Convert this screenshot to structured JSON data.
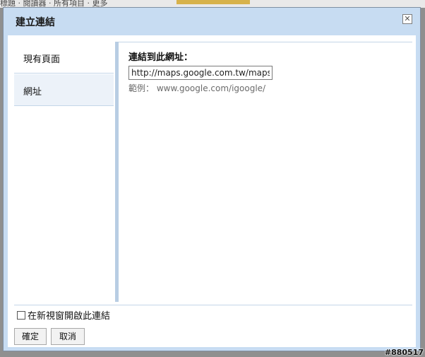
{
  "background": {
    "strip_text": "標題 · 閱讀器 · 所有項目 · 更多"
  },
  "dialog": {
    "title": "建立連結",
    "close_symbol": "✕"
  },
  "sidebar": {
    "items": [
      {
        "label": "現有頁面"
      },
      {
        "label": "網址"
      }
    ]
  },
  "main": {
    "field_label": "連結到此網址：",
    "url_value": "http://maps.google.com.tw/maps?f",
    "example": "範例： www.google.com/igoogle/"
  },
  "footer": {
    "new_window_label": "在新視窗開啟此連結",
    "ok_label": "確定",
    "cancel_label": "取消"
  },
  "watermark": "#880517",
  "colors": {
    "dialog_frame": "#c7dcf2",
    "selected_tab": "#ecf2f9",
    "divider": "#b8cde3"
  }
}
